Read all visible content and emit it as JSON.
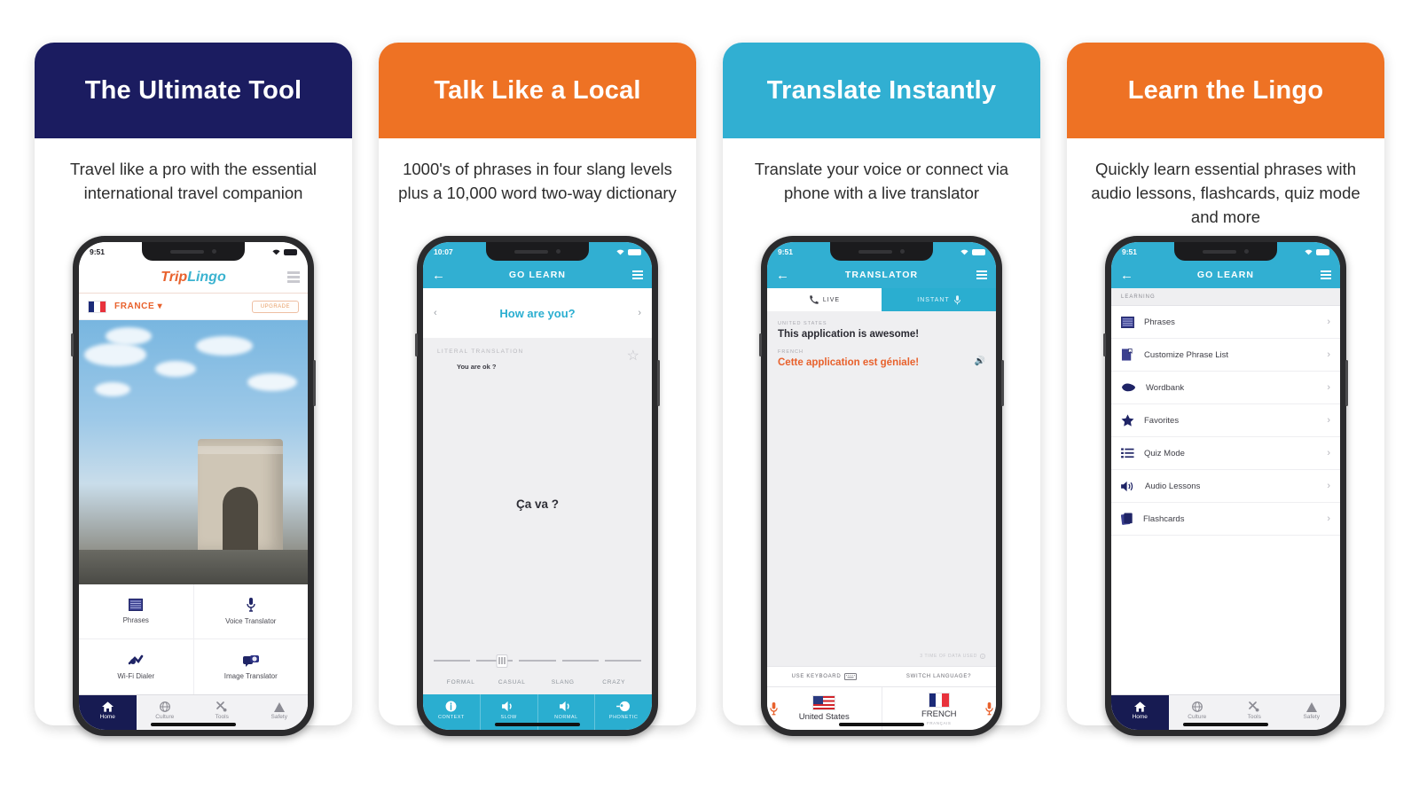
{
  "cards": [
    {
      "title": "The Ultimate Tool",
      "header_color": "#1b1c60",
      "subtitle": "Travel like a pro with the essential international travel companion",
      "phone": {
        "status_time": "9:51",
        "logo": {
          "part1": "Trip",
          "part2": "Lingo"
        },
        "country": "FRANCE",
        "country_caret": "▾",
        "upgrade_label": "UPGRADE",
        "grid": [
          {
            "label": "Phrases",
            "icon": "book-icon"
          },
          {
            "label": "Voice Translator",
            "icon": "microphone-icon"
          },
          {
            "label": "Wi-Fi Dialer",
            "icon": "wifi-dialer-icon"
          },
          {
            "label": "Image Translator",
            "icon": "camera-icon"
          }
        ],
        "tabs": [
          {
            "label": "Home",
            "icon": "home-icon",
            "active": true
          },
          {
            "label": "Culture",
            "icon": "globe-icon",
            "active": false
          },
          {
            "label": "Tools",
            "icon": "tools-icon",
            "active": false
          },
          {
            "label": "Safety",
            "icon": "warning-icon",
            "active": false
          }
        ]
      }
    },
    {
      "title": "Talk Like a Local",
      "header_color": "#ee7224",
      "subtitle": "1000's of phrases in four slang levels plus a 10,000 word two-way dictionary",
      "phone": {
        "status_time": "10:07",
        "nav_title": "GO LEARN",
        "phrase": "How are you?",
        "arrow_left": "‹",
        "arrow_right": "›",
        "literal_label": "LITERAL TRANSLATION",
        "literal_value": "You are ok ?",
        "translation": "Ça va ?",
        "slang_levels": [
          "FORMAL",
          "CASUAL",
          "SLANG",
          "CRAZY"
        ],
        "bottom_actions": [
          {
            "label": "CONTEXT",
            "icon": "info-icon"
          },
          {
            "label": "SLOW",
            "icon": "speaker-icon"
          },
          {
            "label": "NORMAL",
            "icon": "speaker-icon"
          },
          {
            "label": "PHONETIC",
            "icon": "mouth-icon"
          }
        ]
      }
    },
    {
      "title": "Translate Instantly",
      "header_color": "#31afd2",
      "subtitle": "Translate your voice or connect via phone with a live translator",
      "phone": {
        "status_time": "9:51",
        "nav_title": "TRANSLATOR",
        "tabs": [
          {
            "label": "LIVE",
            "icon": "phone-icon",
            "active": true
          },
          {
            "label": "INSTANT",
            "icon": "microphone-icon",
            "active": false
          }
        ],
        "source_label": "UNITED STATES",
        "source_text": "This application is awesome!",
        "target_label": "FRENCH",
        "target_text": "Cette application est géniale!",
        "data_note": "3 TIME OF DATA USED",
        "use_keyboard": "USE KEYBOARD",
        "switch_language": "SWITCH LANGUAGE?",
        "lang_left": {
          "name": "United States",
          "sub": ""
        },
        "lang_right": {
          "name": "FRENCH",
          "sub": "FRANÇAIS"
        }
      }
    },
    {
      "title": "Learn the Lingo",
      "header_color": "#ee7224",
      "subtitle": "Quickly learn essential phrases with audio lessons, flashcards, quiz mode and more",
      "phone": {
        "status_time": "9:51",
        "nav_title": "GO LEARN",
        "section_label": "LEARNING",
        "items": [
          {
            "label": "Phrases",
            "icon": "book-icon"
          },
          {
            "label": "Customize Phrase List",
            "icon": "list-edit-icon"
          },
          {
            "label": "Wordbank",
            "icon": "wordbank-icon"
          },
          {
            "label": "Favorites",
            "icon": "star-icon"
          },
          {
            "label": "Quiz Mode",
            "icon": "list-icon"
          },
          {
            "label": "Audio Lessons",
            "icon": "speaker-icon"
          },
          {
            "label": "Flashcards",
            "icon": "flashcards-icon"
          }
        ],
        "chevron": "›",
        "tabs": [
          {
            "label": "Home",
            "icon": "home-icon",
            "active": true
          },
          {
            "label": "Culture",
            "icon": "globe-icon",
            "active": false
          },
          {
            "label": "Tools",
            "icon": "tools-icon",
            "active": false
          },
          {
            "label": "Safety",
            "icon": "warning-icon",
            "active": false
          }
        ]
      }
    }
  ],
  "colors": {
    "navy": "#1b1c60",
    "orange": "#ee7224",
    "cyan": "#31afd2",
    "brand_orange": "#e8612c"
  }
}
